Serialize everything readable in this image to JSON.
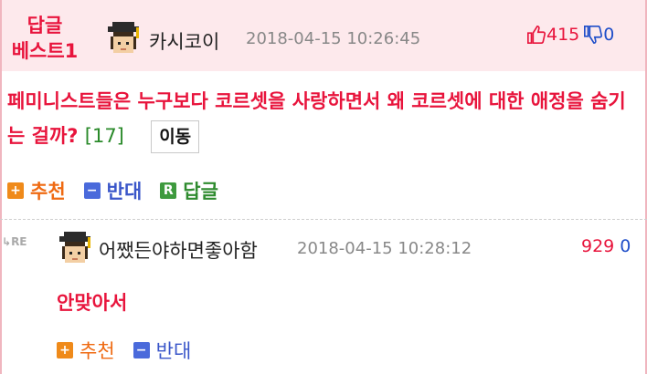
{
  "best_reply": {
    "badge_line1": "답글",
    "badge_line2": "베스트1",
    "author": "카시코이",
    "date": "2018-04-15 10:26:45",
    "upvotes": "415",
    "downvotes": "0",
    "content": "페미니스트들은 누구보다 코르셋을 사랑하면서 왜 코르셋에 대한 애정을 숨기는 걸까?",
    "reply_count": "[17]",
    "move_label": "이동",
    "actions": {
      "recommend": "추천",
      "oppose": "반대",
      "reply": "답글"
    }
  },
  "reply": {
    "re_label": "RE",
    "author": "어쨌든야하면좋아함",
    "date": "2018-04-15 10:28:12",
    "upvotes": "929",
    "downvotes": "0",
    "content": "안맞아서",
    "actions": {
      "recommend": "추천",
      "oppose": "반대"
    }
  },
  "colors": {
    "accent_red": "#e8143c",
    "header_bg": "#fde9ec",
    "vote_up": "#e8143c",
    "vote_down": "#1f4ec9"
  }
}
